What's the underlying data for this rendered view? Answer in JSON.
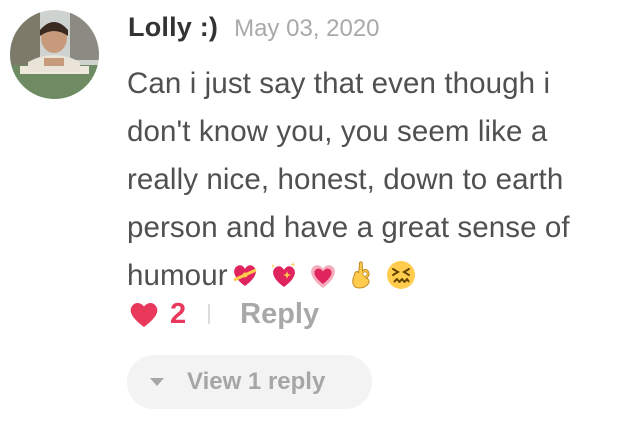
{
  "comment": {
    "author": "Lolly :)",
    "date": "May 03, 2020",
    "text": "Can i just say that even though i don't know you, you seem like a really nice, honest, down to earth person and have a great sense of humour",
    "emojis": [
      "heart-with-ribbon",
      "sparkling-heart",
      "growing-heart",
      "ok-hand",
      "confounded-face"
    ]
  },
  "actions": {
    "like_count": "2",
    "reply_label": "Reply"
  },
  "replies": {
    "view_label": "View 1 reply"
  },
  "colors": {
    "like_red": "#e8385b",
    "muted_gray": "#a8a8a8",
    "text": "#505050"
  }
}
